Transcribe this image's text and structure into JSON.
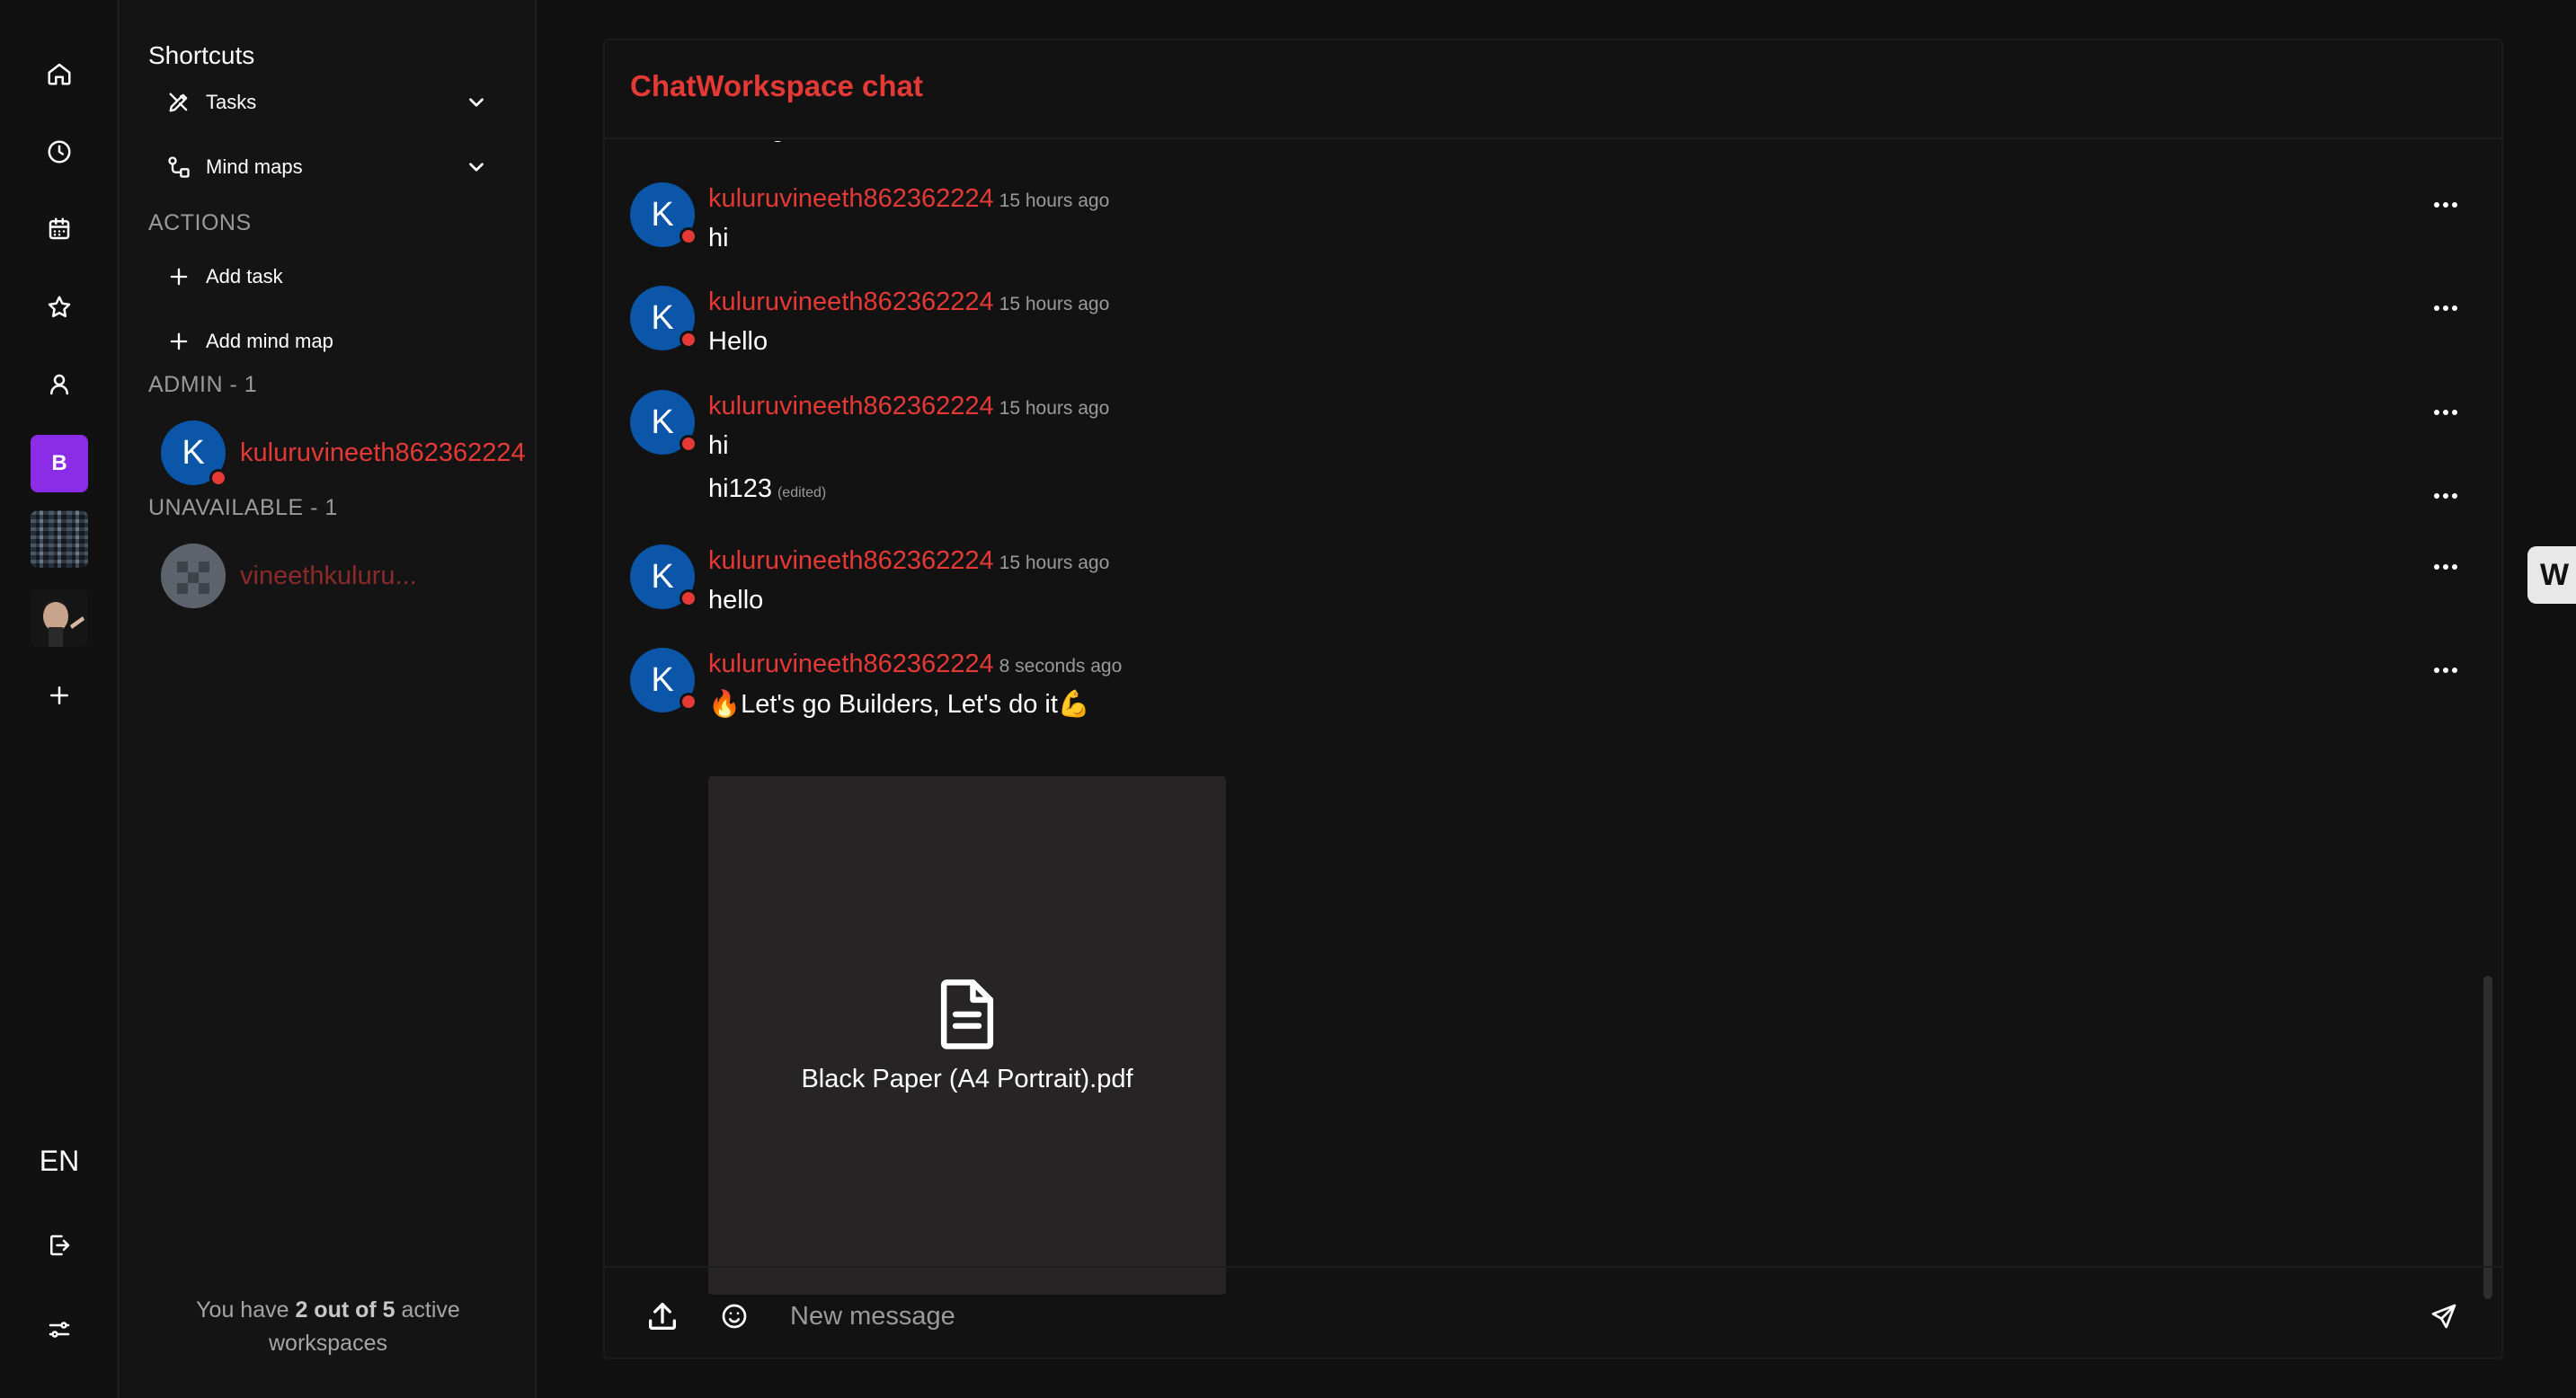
{
  "rail": {
    "icons": [
      "home-icon",
      "clock-icon",
      "calendar-icon",
      "star-icon",
      "user-icon"
    ],
    "workspace_letter": "B",
    "language": "EN"
  },
  "sidebar": {
    "shortcuts_title": "Shortcuts",
    "items": [
      {
        "label": "Tasks"
      },
      {
        "label": "Mind maps"
      }
    ],
    "actions_label": "ACTIONS",
    "actions": [
      {
        "label": "Add task"
      },
      {
        "label": "Add mind map"
      }
    ],
    "admin_label": "ADMIN - 1",
    "admin_member": {
      "initial": "K",
      "name": "kuluruvineeth862362224"
    },
    "unavailable_label": "UNAVAILABLE - 1",
    "unavailable_member": {
      "name": "vineethkuluru..."
    },
    "footer": {
      "prefix": "You have ",
      "count": "2 out of 5",
      "suffix": " active workspaces"
    }
  },
  "chat": {
    "title": "ChatWorkspace chat",
    "partial_text": "testing",
    "messages": [
      {
        "initial": "K",
        "author": "kuluruvineeth862362224",
        "time": "15 hours ago",
        "text": "hi"
      },
      {
        "initial": "K",
        "author": "kuluruvineeth862362224",
        "time": "15 hours ago",
        "text": "Hello"
      },
      {
        "initial": "K",
        "author": "kuluruvineeth862362224",
        "time": "15 hours ago",
        "text": "hi",
        "followup": "hi123",
        "followup_edited": "(edited)"
      },
      {
        "initial": "K",
        "author": "kuluruvineeth862362224",
        "time": "15 hours ago",
        "text": "hello"
      },
      {
        "initial": "K",
        "author": "kuluruvineeth862362224",
        "time": "8 seconds ago",
        "text": "🔥Let's go Builders, Let's do it💪"
      }
    ],
    "attachment": {
      "filename": "Black Paper (A4 Portrait).pdf"
    },
    "composer": {
      "placeholder": "New message"
    }
  },
  "edge_tab": {
    "label": "W"
  },
  "colors": {
    "accent": "#e53935",
    "avatar": "#0b56a8",
    "workspace": "#8b2ce6",
    "background": "#111111"
  }
}
